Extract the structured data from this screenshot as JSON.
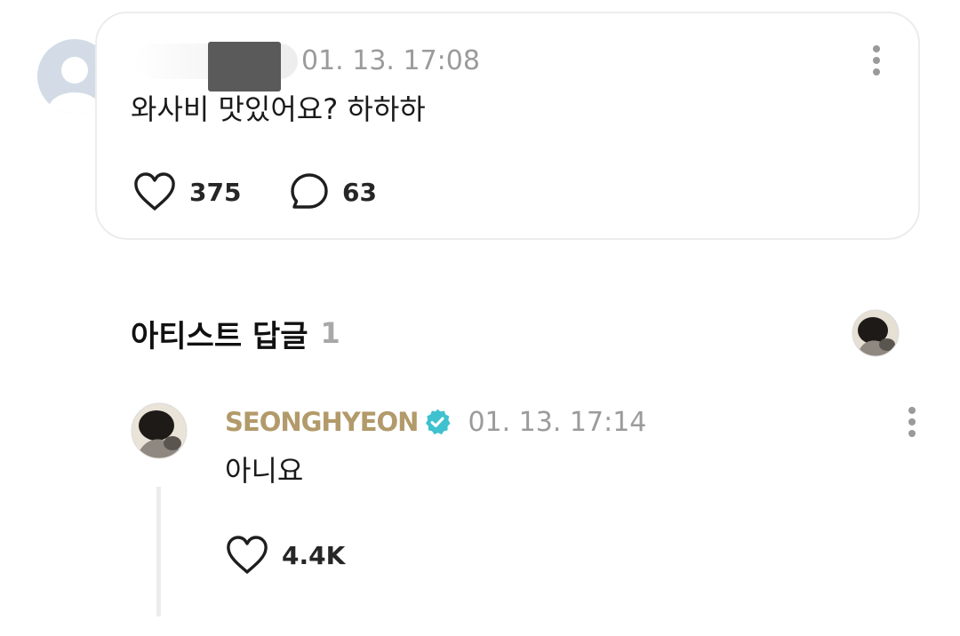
{
  "post": {
    "time": "01. 13. 17:08",
    "text": "와사비 맛있어요? 하하하",
    "like_count": "375",
    "comment_count": "63"
  },
  "artist_reply": {
    "section_title": "아티스트 답글",
    "count": "1",
    "author": "SEONGHYEON",
    "time": "01. 13. 17:14",
    "text": "아니요",
    "like_count": "4.4K"
  },
  "icons": {
    "avatar": "default-avatar-icon",
    "more": "more-vertical-icon",
    "like": "heart-outline-icon",
    "comment": "speech-bubble-icon",
    "verified": "verified-badge-icon"
  },
  "colors": {
    "artist_name": "#b29a6a",
    "verified_badge": "#3fc1cf",
    "muted_text": "#9b9b9b",
    "card_border": "#ececec",
    "default_avatar": "#d3dce6"
  }
}
